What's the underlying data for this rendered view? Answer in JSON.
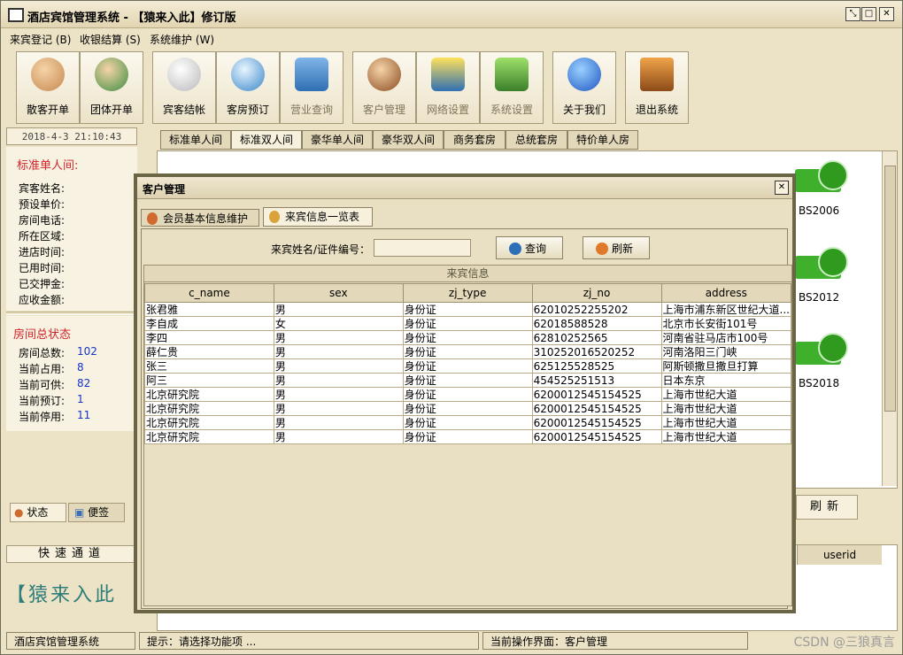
{
  "window": {
    "title": "酒店宾馆管理系统 - 【猿来入此】修订版"
  },
  "menu": [
    {
      "label": "来宾登记 (B)"
    },
    {
      "label": "收银结算 (S)"
    },
    {
      "label": "系统维护 (W)"
    }
  ],
  "toolbar": [
    {
      "label": "散客开单",
      "icon": "guest-icon",
      "enabled": true
    },
    {
      "label": "团体开单",
      "icon": "group-icon",
      "enabled": true
    },
    {
      "label": "宾客结帐",
      "icon": "checkout-icon",
      "enabled": true
    },
    {
      "label": "客房预订",
      "icon": "compass-icon",
      "enabled": true
    },
    {
      "label": "营业查询",
      "icon": "magnifier-icon",
      "enabled": false
    },
    {
      "label": "客户管理",
      "icon": "customer-icon",
      "enabled": false
    },
    {
      "label": "网络设置",
      "icon": "network-icon",
      "enabled": false
    },
    {
      "label": "系统设置",
      "icon": "settings-icon",
      "enabled": false
    },
    {
      "label": "关于我们",
      "icon": "about-icon",
      "enabled": true
    },
    {
      "label": "退出系统",
      "icon": "exit-icon",
      "enabled": true
    }
  ],
  "left": {
    "clock": "2018-4-3  21:10:43",
    "room_info": {
      "heading": "标准单人间:",
      "fields": [
        "宾客姓名:",
        "预设单价:",
        "房间电话:",
        "所在区域:",
        "进店时间:",
        "已用时间:",
        "已交押金:",
        "应收金额:"
      ]
    },
    "room_status": {
      "heading": "房间总状态",
      "items": [
        {
          "label": "房间总数:",
          "value": "102"
        },
        {
          "label": "当前占用:",
          "value": "8"
        },
        {
          "label": "当前可供:",
          "value": "82"
        },
        {
          "label": "当前预订:",
          "value": "1"
        },
        {
          "label": "当前停用:",
          "value": "11"
        }
      ]
    },
    "tabs": [
      "状态",
      "便签"
    ],
    "quick_title": "快速通道",
    "brand": "【猿来入此"
  },
  "room_tabs": [
    "标准单人间",
    "标准双人间",
    "豪华单人间",
    "豪华双人间",
    "商务套房",
    "总统套房",
    "特价单人房"
  ],
  "rooms": [
    "BS2006",
    "BS2012",
    "BS2018"
  ],
  "refresh_label": "刷新",
  "bottom_table": {
    "header": "userid"
  },
  "status": {
    "app_name": "酒店宾馆管理系统",
    "hint": "提示：请选择功能项 ...",
    "current": "当前操作界面：客户管理",
    "watermark": "CSDN @三狼真言"
  },
  "dialog": {
    "title": "客户管理",
    "tabs": [
      "会员基本信息维护",
      "来宾信息一览表"
    ],
    "search_label": "来宾姓名/证件编号：",
    "search_value": "",
    "query_label": "查询",
    "refresh_label": "刷新",
    "caption": "来宾信息",
    "columns": [
      "c_name",
      "sex",
      "zj_type",
      "zj_no",
      "address"
    ],
    "rows": [
      [
        "张君雅",
        "男",
        "身份证",
        "62010252255202",
        "上海市浦东新区世纪大道..."
      ],
      [
        "李自成",
        "女",
        "身份证",
        "62018588528",
        "北京市长安街101号"
      ],
      [
        "李四",
        "男",
        "身份证",
        "62810252565",
        "河南省驻马店市100号"
      ],
      [
        "薛仁贵",
        "男",
        "身份证",
        "310252016520252",
        "河南洛阳三门峡"
      ],
      [
        "张三",
        "男",
        "身份证",
        "625125528525",
        "阿斯顿撒旦撒旦打算"
      ],
      [
        "阿三",
        "男",
        "身份证",
        "454525251513",
        "日本东京"
      ],
      [
        "北京研究院",
        "男",
        "身份证",
        "6200012545154525",
        "上海市世纪大道"
      ],
      [
        "北京研究院",
        "男",
        "身份证",
        "6200012545154525",
        "上海市世纪大道"
      ],
      [
        "北京研究院",
        "男",
        "身份证",
        "6200012545154525",
        "上海市世纪大道"
      ],
      [
        "北京研究院",
        "男",
        "身份证",
        "6200012545154525",
        "上海市世纪大道"
      ]
    ]
  }
}
